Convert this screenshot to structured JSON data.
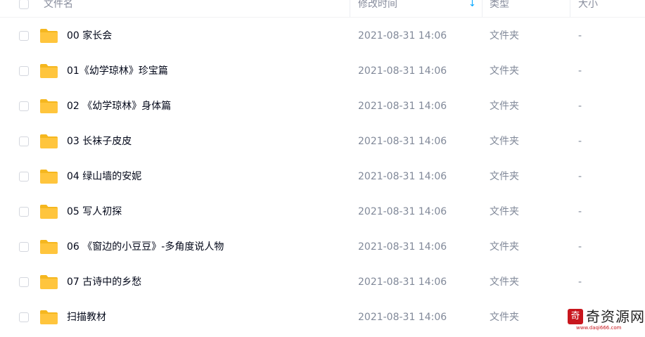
{
  "header": {
    "name_label": "文件名",
    "time_label": "修改时间",
    "type_label": "类型",
    "size_label": "大小",
    "sort_icon": "↓"
  },
  "rows": [
    {
      "name": "00 家长会",
      "time": "2021-08-31 14:06",
      "type": "文件夹",
      "size": "-"
    },
    {
      "name": "01《幼学琼林》珍宝篇",
      "time": "2021-08-31 14:06",
      "type": "文件夹",
      "size": "-"
    },
    {
      "name": "02 《幼学琼林》身体篇",
      "time": "2021-08-31 14:06",
      "type": "文件夹",
      "size": "-"
    },
    {
      "name": "03 长袜子皮皮",
      "time": "2021-08-31 14:06",
      "type": "文件夹",
      "size": "-"
    },
    {
      "name": "04 绿山墙的安妮",
      "time": "2021-08-31 14:06",
      "type": "文件夹",
      "size": "-"
    },
    {
      "name": "05 写人初探",
      "time": "2021-08-31 14:06",
      "type": "文件夹",
      "size": "-"
    },
    {
      "name": "06 《窗边的小豆豆》-多角度说人物",
      "time": "2021-08-31 14:06",
      "type": "文件夹",
      "size": "-"
    },
    {
      "name": "07 古诗中的乡愁",
      "time": "2021-08-31 14:06",
      "type": "文件夹",
      "size": "-"
    },
    {
      "name": "扫描教材",
      "time": "2021-08-31 14:06",
      "type": "文件夹",
      "size": ""
    }
  ],
  "watermark": {
    "seal": "奇",
    "text": "奇资源网",
    "url": "www.daqi666.com"
  },
  "colors": {
    "folder": "#ffc53d",
    "folder_tab": "#f5b71f",
    "accent": "#06a7ff",
    "seal": "#c8161d"
  }
}
